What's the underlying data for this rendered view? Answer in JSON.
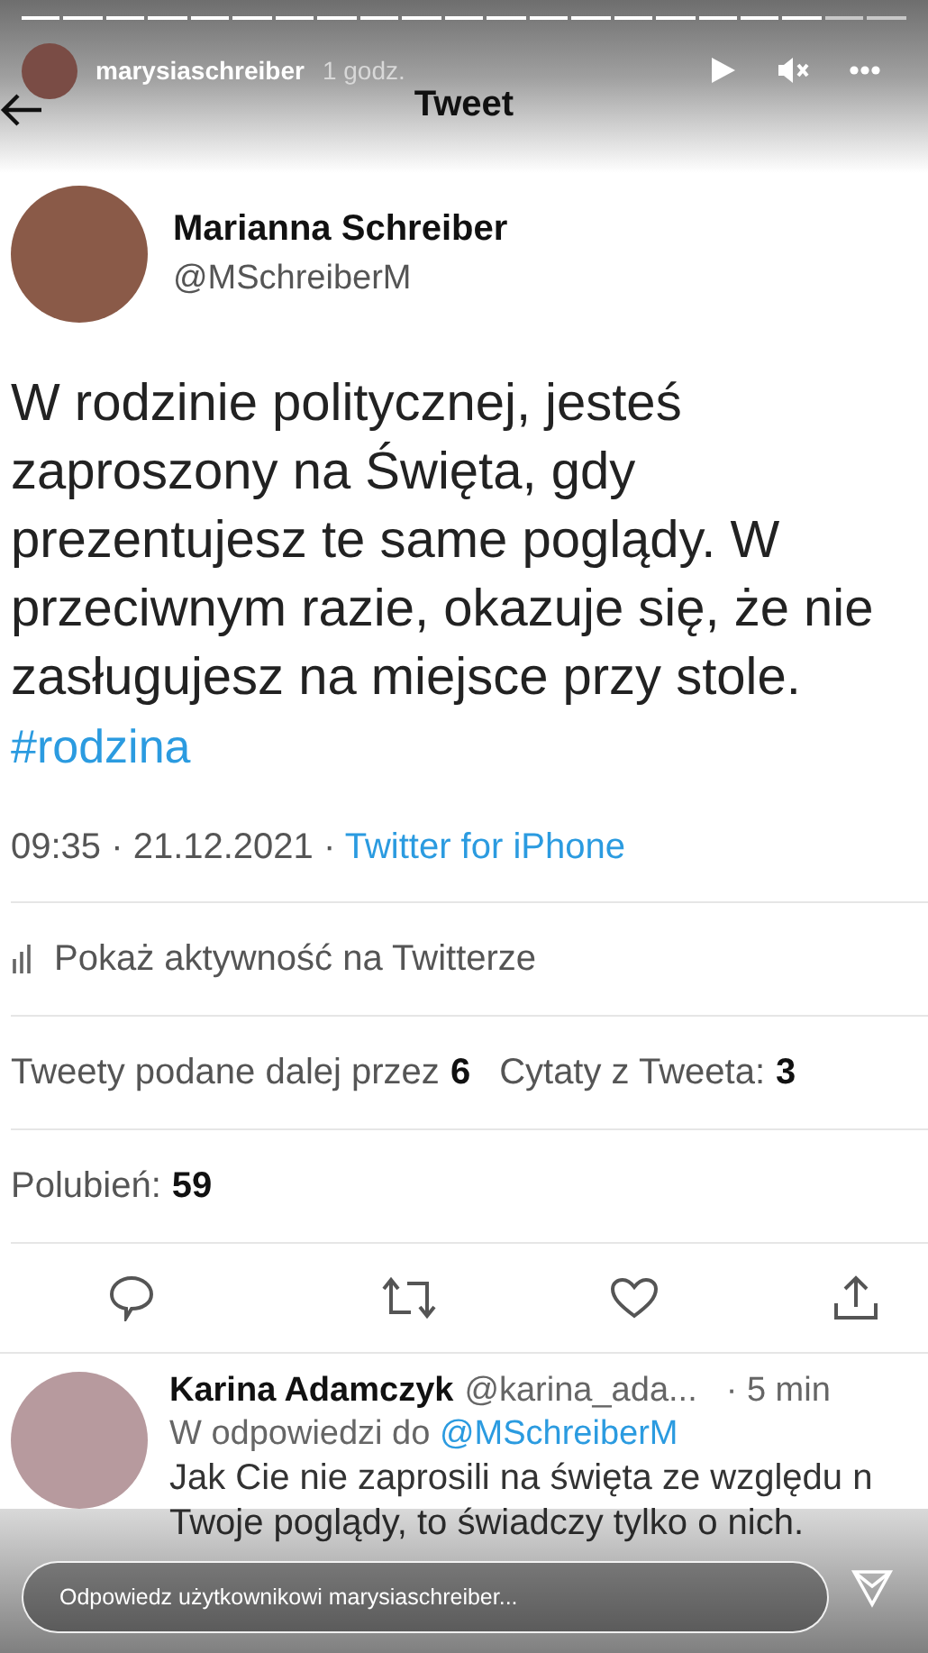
{
  "story": {
    "username": "marysiaschreiber",
    "time": "1 godz.",
    "reply_placeholder": "Odpowiedz użytkownikowi marysiaschreiber..."
  },
  "screen": {
    "title": "Tweet"
  },
  "tweet": {
    "name": "Marianna Schreiber",
    "handle": "@MSchreiberM",
    "text": "W rodzinie politycznej, jesteś zaproszony na Święta, gdy prezentujesz te same poglądy. W przeciwnym razie, okazuje się, że nie zasługujesz na miejsce przy stole.",
    "hashtag": "#rodzina",
    "timestamp": "09:35 · 21.12.2021 · ",
    "source": "Twitter for iPhone",
    "activity": "Pokaż aktywność na Twitterze",
    "retweets_label": "Tweety podane dalej przez",
    "retweets": "6",
    "quotes_label": "Cytaty z Tweeta:",
    "quotes": "3",
    "likes_label": "Polubień:",
    "likes": "59"
  },
  "reply": {
    "name": "Karina Adamczyk",
    "handle": "@karina_ada...",
    "time": "· 5 min",
    "in_reply_prefix": "W odpowiedzi do",
    "in_reply_handle": "@MSchreiberM",
    "lines": [
      "Jak Cie nie zaprosili na święta ze względu n",
      "Twoje poglądy, to świadczy tylko o nich."
    ]
  }
}
